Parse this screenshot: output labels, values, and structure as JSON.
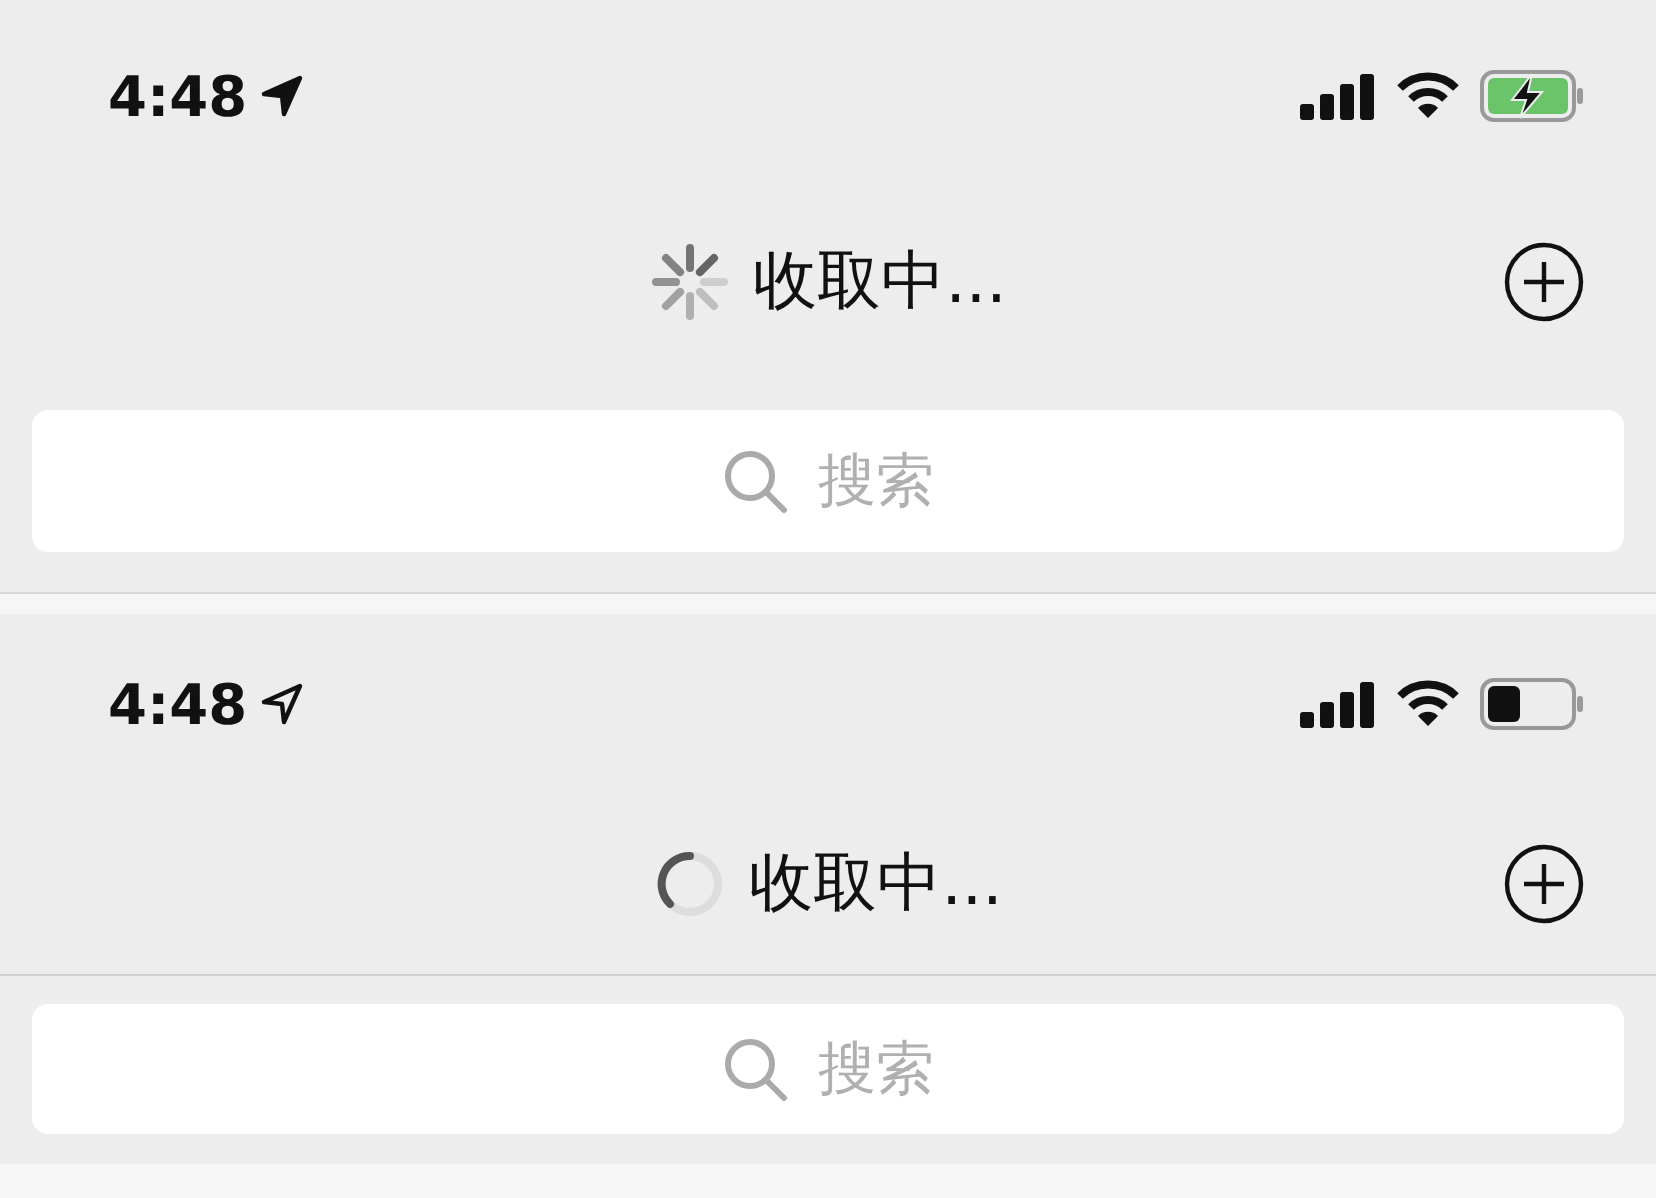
{
  "screens": [
    {
      "status_bar": {
        "time": "4:48",
        "location_filled": true,
        "battery_charging": true
      },
      "header": {
        "title": "收取中...",
        "spinner": {
          "kind": "spokes"
        },
        "divider": false
      },
      "search": {
        "placeholder": "搜索"
      }
    },
    {
      "status_bar": {
        "time": "4:48",
        "location_filled": false,
        "battery_charging": false
      },
      "header": {
        "title": "收取中...",
        "spinner": {
          "kind": "ring"
        },
        "divider": true
      },
      "search": {
        "placeholder": "搜索"
      }
    }
  ]
}
